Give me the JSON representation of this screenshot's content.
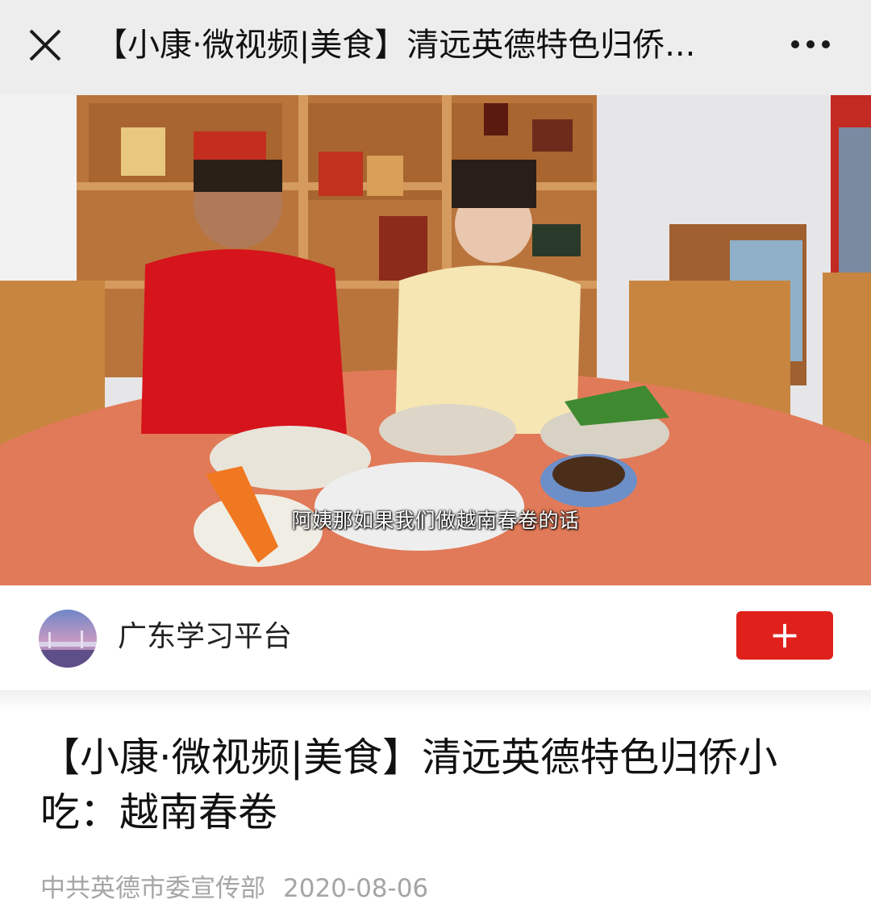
{
  "topbar": {
    "title": "【小康·微视频|美食】清远英德特色归侨...",
    "close_icon": "close-icon",
    "more_icon": "more-icon"
  },
  "video": {
    "subtitle": "阿姨那如果我们做越南春卷的话"
  },
  "account": {
    "name": "广东学习平台",
    "follow_label": "+"
  },
  "article": {
    "title": "【小康·微视频|美食】清远英德特色归侨小吃：越南春卷",
    "author": "中共英德市委宣传部",
    "date": "2020-08-06"
  },
  "colors": {
    "topbar_bg": "#ededed",
    "follow_button": "#e0211b",
    "meta_text": "#a5a5a5"
  }
}
